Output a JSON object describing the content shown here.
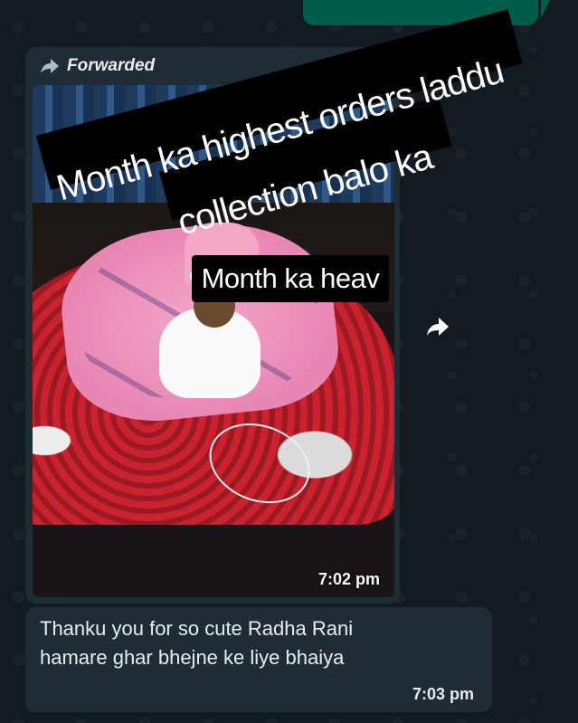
{
  "chat": {
    "message1": {
      "forwarded_label": "Forwarded",
      "forwarded_icon": "forward-arrow-icon",
      "overlay_text_line1": "Month ka highest orders laddu",
      "overlay_text_line2": "collection balo ka",
      "overlay_label": "Month ka heav",
      "time": "7:02 pm"
    },
    "message2": {
      "line1": "Thanku you for so cute Radha Rani",
      "line2": "hamare ghar bhejne ke liye bhaiya",
      "time": "7:03 pm"
    },
    "forward_button_icon": "forward-share-icon"
  },
  "colors": {
    "background": "#0b141a",
    "incoming_bubble": "#1f2c34",
    "outgoing_bubble": "#005c4b",
    "text": "#e9edef"
  }
}
